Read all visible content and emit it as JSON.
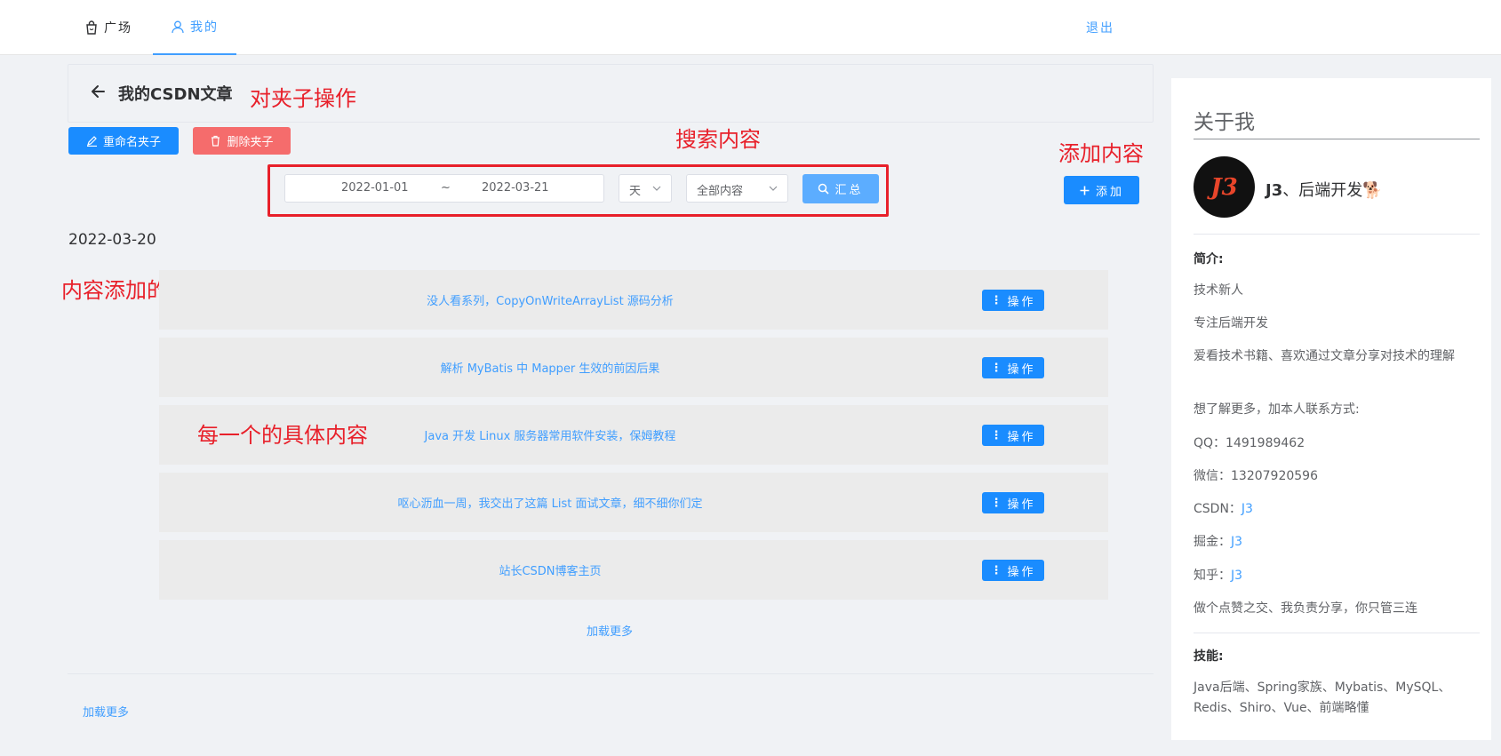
{
  "nav": {
    "square_label": "广场",
    "mine_label": "我的",
    "logout_label": "退出"
  },
  "header": {
    "title": "我的CSDN文章"
  },
  "toolbar": {
    "rename_label": "重命名夹子",
    "delete_label": "删除夹子"
  },
  "search": {
    "start_date": "2022-01-01",
    "separator": "~",
    "end_date": "2022-03-21",
    "unit_value": "天",
    "scope_value": "全部内容",
    "summary_label": "汇总"
  },
  "add_label": "添加",
  "annotations": {
    "folder_ops": "对夹子操作",
    "search": "搜索内容",
    "add": "添加内容",
    "time": "内容添加的时间",
    "item": "每一个的具体内容"
  },
  "group": {
    "date": "2022-03-20",
    "articles": [
      {
        "title": "没人看系列，CopyOnWriteArrayList 源码分析",
        "action": "操作"
      },
      {
        "title": "解析 MyBatis 中 Mapper 生效的前因后果",
        "action": "操作"
      },
      {
        "title": "Java 开发 Linux 服务器常用软件安装，保姆教程",
        "action": "操作"
      },
      {
        "title": "呕心沥血一周，我交出了这篇 List 面试文章，细不细你们定",
        "action": "操作"
      },
      {
        "title": "站长CSDN博客主页",
        "action": "操作"
      }
    ],
    "load_more": "加载更多"
  },
  "load_more_outer": "加载更多",
  "about": {
    "title": "关于我",
    "avatar_text": "J3",
    "name_bold": "J3",
    "name_rest": "、后端开发🐕",
    "intro_label": "简介:",
    "intro_lines": [
      "技术新人",
      "专注后端开发",
      "爱看技术书籍、喜欢通过文章分享对技术的理解",
      "想了解更多，加本人联系方式:",
      "QQ：1491989462",
      "微信：13207920596"
    ],
    "csdn_prefix": "CSDN：",
    "csdn_link": "J3",
    "juejin_prefix": "掘金：",
    "juejin_link": "J3",
    "zhihu_prefix": "知乎：",
    "zhihu_link": "J3",
    "motto": "做个点赞之交、我负责分享，你只管三连",
    "skills_label": "技能:",
    "skills": "Java后端、Spring家族、Mybatis、MySQL、Redis、Shiro、Vue、前端略懂"
  },
  "colors": {
    "primary": "#1a8cff",
    "danger": "#f56c6c",
    "annotation": "#e8202a",
    "link": "#409eff"
  }
}
